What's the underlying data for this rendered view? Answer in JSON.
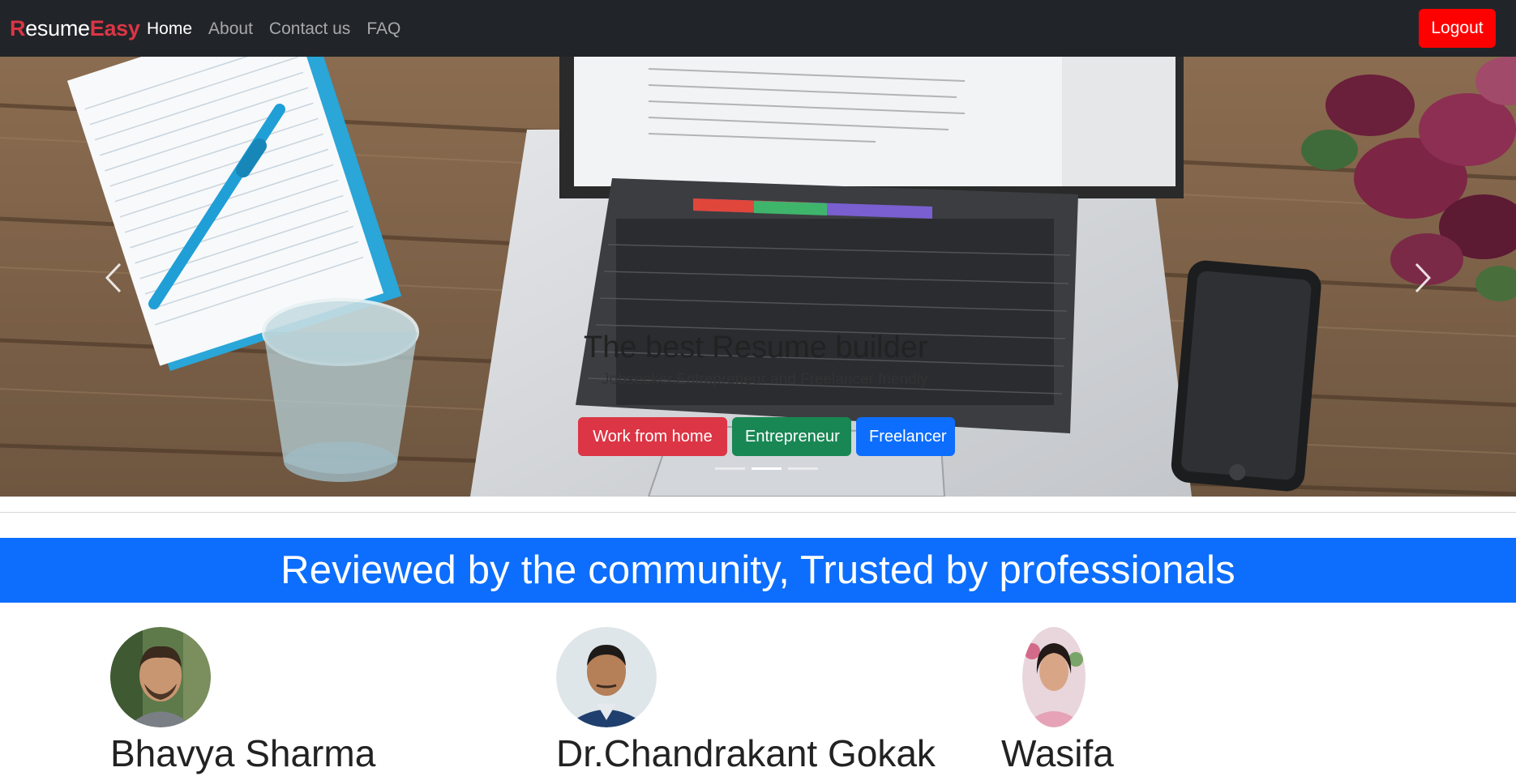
{
  "navbar": {
    "brand_first": "R",
    "brand_mid": "esume",
    "brand_last": "Easy",
    "links": [
      {
        "label": "Home",
        "active": true
      },
      {
        "label": "About",
        "active": false
      },
      {
        "label": "Contact us",
        "active": false
      },
      {
        "label": "FAQ",
        "active": false
      }
    ],
    "logout_label": "Logout"
  },
  "hero": {
    "title": "The best Resume builder",
    "subtitle": "Jobseeker,Entrepreneur and Freelancer friendly",
    "buttons": [
      {
        "label": "Work from home",
        "color": "#dc3545"
      },
      {
        "label": "Entrepreneur",
        "color": "#198754"
      },
      {
        "label": "Freelancer",
        "color": "#0d6efd"
      }
    ],
    "active_slide": 2,
    "slide_count": 3,
    "prev_icon": "chevron-left-icon",
    "next_icon": "chevron-right-icon"
  },
  "banner": {
    "title": "Reviewed by the community, Trusted by professionals",
    "color": "#0d6efd"
  },
  "reviewers": [
    {
      "name": "Bhavya Sharma"
    },
    {
      "name": "Dr.Chandrakant Gokak"
    },
    {
      "name": "Wasifa"
    }
  ],
  "colors": {
    "navbar_bg": "#212529",
    "logout": "#ff0000",
    "brand_accent": "#dc3545"
  }
}
